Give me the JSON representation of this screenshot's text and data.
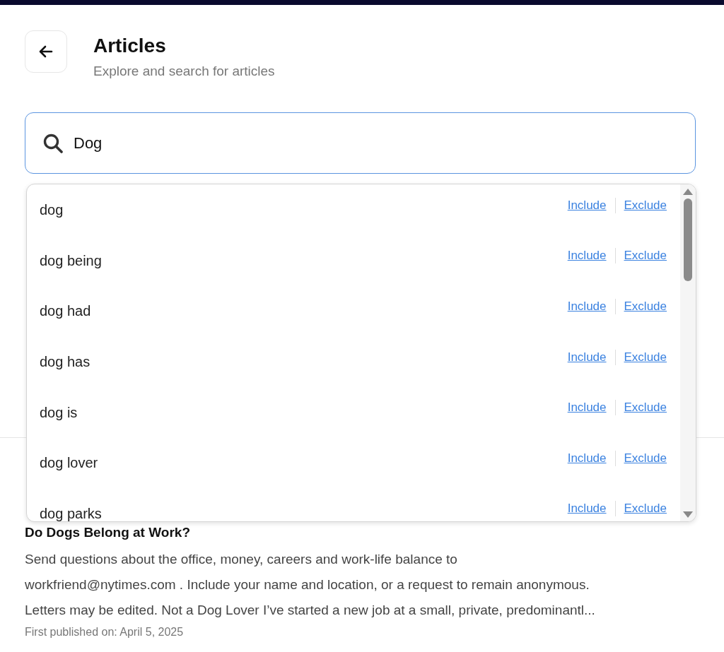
{
  "header": {
    "title": "Articles",
    "subtitle": "Explore and search for articles"
  },
  "search": {
    "value": "Dog"
  },
  "suggestions": [
    {
      "term": "dog",
      "include": "Include",
      "exclude": "Exclude"
    },
    {
      "term": "dog being",
      "include": "Include",
      "exclude": "Exclude"
    },
    {
      "term": "dog had",
      "include": "Include",
      "exclude": "Exclude"
    },
    {
      "term": "dog has",
      "include": "Include",
      "exclude": "Exclude"
    },
    {
      "term": "dog is",
      "include": "Include",
      "exclude": "Exclude"
    },
    {
      "term": "dog lover",
      "include": "Include",
      "exclude": "Exclude"
    },
    {
      "term": "dog parks",
      "include": "Include",
      "exclude": "Exclude"
    }
  ],
  "article": {
    "title": "Do Dogs Belong at Work?",
    "snippet": "Send questions about the office, money, careers and work-life balance to\nworkfriend@nytimes.com . Include your name and location, or a request to remain anonymous.\nLetters may be edited. Not a Dog Lover I’ve started a new job at a small, private, predominantl...",
    "date": "First published on: April 5, 2025"
  }
}
